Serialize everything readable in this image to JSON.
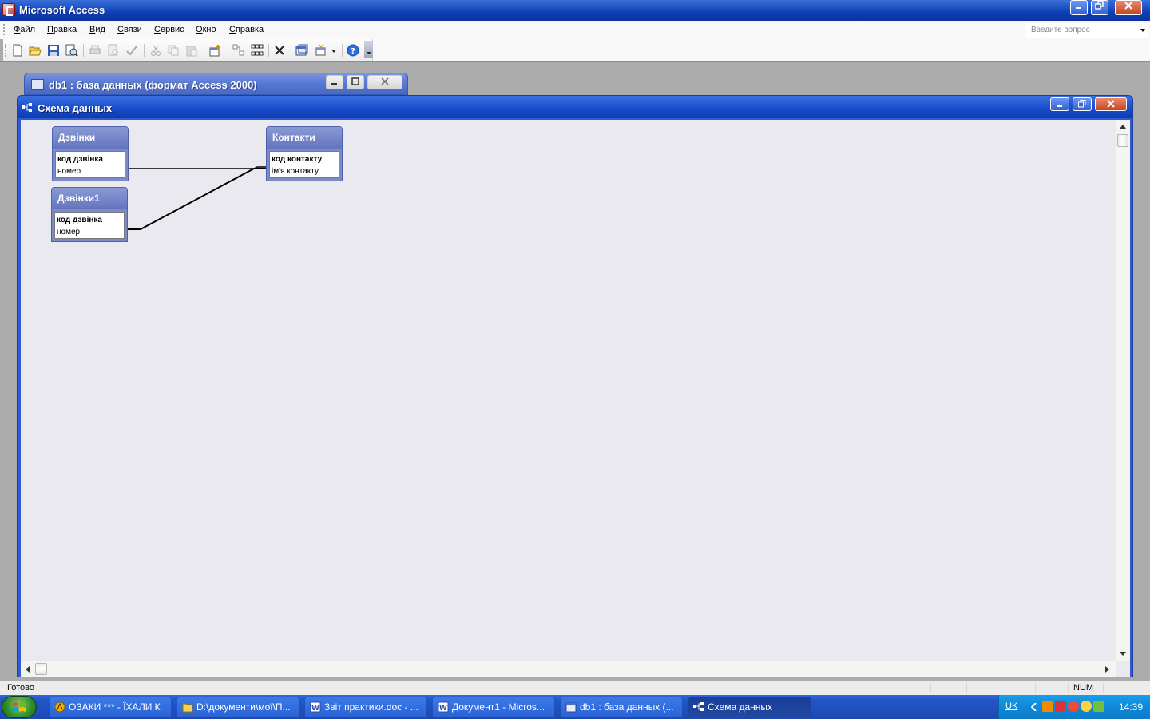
{
  "app": {
    "title": "Microsoft Access"
  },
  "menu": {
    "items": [
      "Файл",
      "Правка",
      "Вид",
      "Связи",
      "Сервис",
      "Окно",
      "Справка"
    ],
    "ask_placeholder": "Введите вопрос"
  },
  "db_window": {
    "title": "db1 : база данных (формат Access 2000)"
  },
  "schema_window": {
    "title": "Схема данных",
    "tables": [
      {
        "name": "Дзвінки",
        "fields": [
          "код дзвінка",
          "номер"
        ]
      },
      {
        "name": "Дзвінки1",
        "fields": [
          "код дзвінка",
          "номер"
        ]
      },
      {
        "name": "Контакти",
        "fields": [
          "код контакту",
          "ім'я контакту"
        ]
      }
    ],
    "relationships": [
      {
        "from": "Дзвінки.номер",
        "to": "Контакти.код контакту"
      },
      {
        "from": "Дзвінки1.номер",
        "to": "Контакти.код контакту"
      }
    ]
  },
  "statusbar": {
    "status": "Готово",
    "num": "NUM"
  },
  "taskbar": {
    "tasks": [
      "ОЗАКИ *** - ЇХАЛИ К",
      "D:\\документи\\мої\\П...",
      "Звіт практики.doc - ...",
      "Документ1 - Micros...",
      "db1 : база данных (...",
      "Схема данных"
    ],
    "language": "UK",
    "clock": "14:39"
  },
  "colors": {
    "title_bar": "#0f3fb3",
    "table_header": "#6374bf",
    "workspace": "#eae9ef",
    "taskbar": "#2456c8"
  }
}
